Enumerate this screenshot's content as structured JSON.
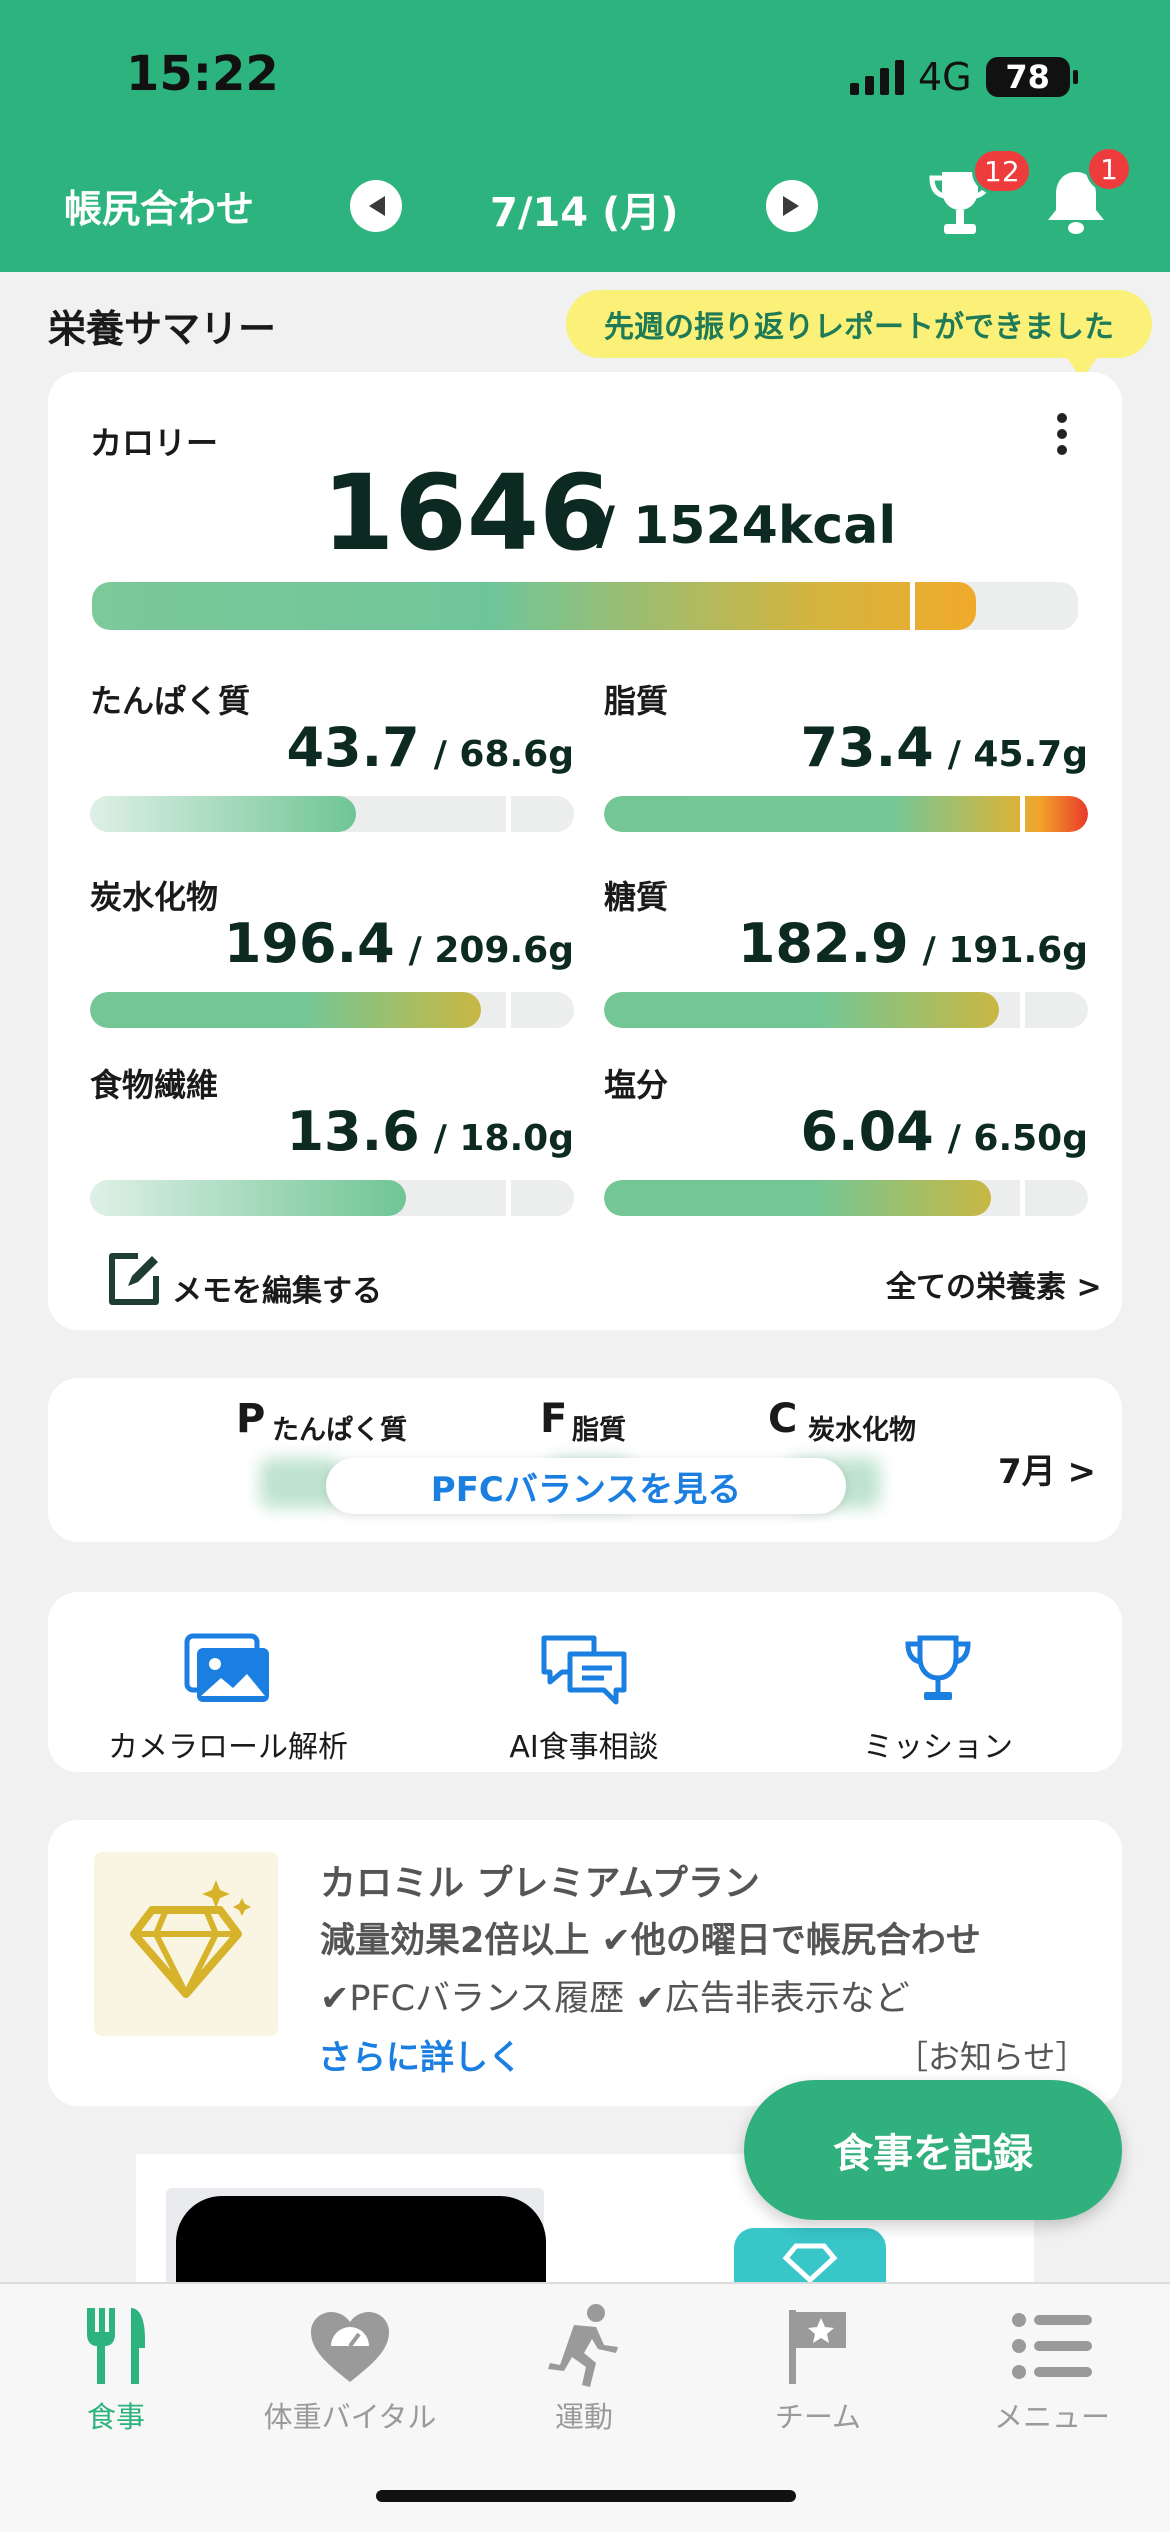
{
  "status_bar": {
    "time": "15:22",
    "network": "4G",
    "battery": "78"
  },
  "header": {
    "title": "帳尻合わせ",
    "date": "7/14 (月)",
    "trophy_badge": "12",
    "bell_badge": "1"
  },
  "summary": {
    "title": "栄養サマリー",
    "tooltip": "先週の振り返りレポートができました",
    "calorie": {
      "label": "カロリー",
      "value": "1646",
      "target": "/ 1524kcal",
      "progress": 1.08
    },
    "nutrients": [
      {
        "label": "たんぱく質",
        "value": "43.7",
        "target": "/ 68.6g",
        "progress": 0.64
      },
      {
        "label": "脂質",
        "value": "73.4",
        "target": "/ 45.7g",
        "progress": 1.6
      },
      {
        "label": "炭水化物",
        "value": "196.4",
        "target": "/ 209.6g",
        "progress": 0.94
      },
      {
        "label": "糖質",
        "value": "182.9",
        "target": "/ 191.6g",
        "progress": 0.95
      },
      {
        "label": "食物繊維",
        "value": "13.6",
        "target": "/ 18.0g",
        "progress": 0.76
      },
      {
        "label": "塩分",
        "value": "6.04",
        "target": "/ 6.50g",
        "progress": 0.93
      }
    ],
    "memo": "メモを編集する",
    "all_nutrients": "全ての栄養素 >"
  },
  "pfc": {
    "p_letter": "P",
    "p_label": "たんぱく質",
    "f_letter": "F",
    "f_label": "脂質",
    "c_letter": "C",
    "c_label": "炭水化物",
    "button": "PFCバランスを見る",
    "month": "7月 >"
  },
  "quick": [
    {
      "label": "カメラロール解析",
      "icon": "photos-icon"
    },
    {
      "label": "AI食事相談",
      "icon": "chat-icon"
    },
    {
      "label": "ミッション",
      "icon": "trophy-icon"
    }
  ],
  "premium": {
    "title": "カロミル プレミアムプラン",
    "line1": "減量効果2倍以上 ✔他の曜日で帳尻合わせ",
    "line2": "✔PFCバランス履歴 ✔広告非表示など",
    "more": "さらに詳しく",
    "notice": "［お知らせ］"
  },
  "fab": "食事を記録",
  "bottom_nav": [
    {
      "label": "食事",
      "icon": "fork-knife-icon",
      "active": true
    },
    {
      "label": "体重バイタル",
      "icon": "heart-scale-icon",
      "active": false
    },
    {
      "label": "運動",
      "icon": "runner-icon",
      "active": false
    },
    {
      "label": "チーム",
      "icon": "flag-icon",
      "active": false
    },
    {
      "label": "メニュー",
      "icon": "list-icon",
      "active": false
    }
  ],
  "colors": {
    "brand": "#2db37e",
    "link": "#1a7fe0",
    "badge": "#ee3b3b",
    "tooltip": "#fbf078"
  }
}
